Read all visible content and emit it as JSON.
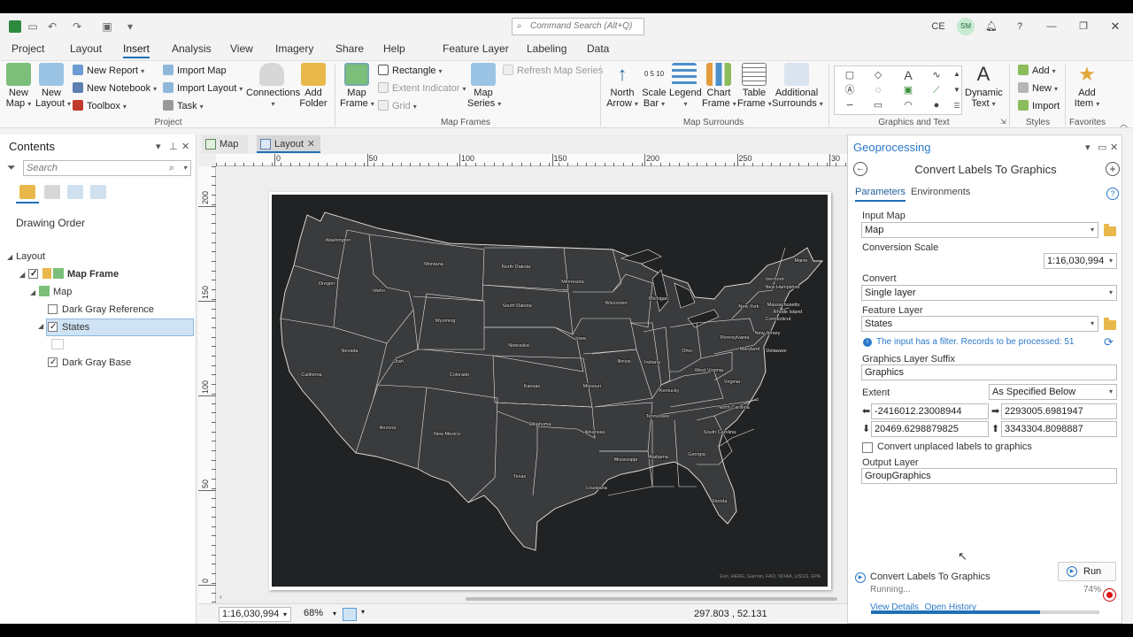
{
  "titlebar": {
    "command_search_placeholder": "Command Search (Alt+Q)",
    "user_initials": "CE",
    "avatar_initials": "SM"
  },
  "menu_tabs": [
    "Project",
    "Layout",
    "Insert",
    "Analysis",
    "View",
    "Imagery",
    "Share",
    "Help"
  ],
  "active_menu_tab": "Insert",
  "contextual_tabs": {
    "group": "Feature Layer",
    "tabs": [
      "Labeling",
      "Data"
    ]
  },
  "ribbon": {
    "project": {
      "group_label": "Project",
      "new_map": "New Map",
      "new_layout": "New Layout",
      "new_report": "New Report",
      "new_notebook": "New Notebook",
      "toolbox": "Toolbox",
      "import_map": "Import Map",
      "import_layout": "Import Layout",
      "task": "Task",
      "connections": "Connections",
      "add_folder": "Add Folder"
    },
    "map_frames": {
      "group_label": "Map Frames",
      "map_frame": "Map Frame",
      "rectangle": "Rectangle",
      "extent_indicator": "Extent Indicator",
      "grid": "Grid",
      "map_series": "Map Series",
      "refresh_map_series": "Refresh Map Series"
    },
    "map_surrounds": {
      "group_label": "Map Surrounds",
      "north_arrow": "North Arrow",
      "scale_bar": "Scale Bar",
      "legend": "Legend",
      "chart_frame": "Chart Frame",
      "table_frame": "Table Frame",
      "additional_surrounds": "Additional Surrounds"
    },
    "graphics_and_text": {
      "group_label": "Graphics and Text",
      "dynamic_text": "Dynamic Text"
    },
    "styles": {
      "group_label": "Styles",
      "add": "Add",
      "new": "New",
      "import": "Import"
    },
    "favorites": {
      "group_label": "Favorites",
      "add_item": "Add Item"
    }
  },
  "contents": {
    "title": "Contents",
    "search_placeholder": "Search",
    "section": "Drawing Order",
    "tree": [
      {
        "label": "Layout",
        "bold": false
      },
      {
        "label": "Map Frame",
        "bold": true
      },
      {
        "label": "Map",
        "bold": false
      },
      {
        "label": "Dark Gray Reference",
        "bold": false,
        "checked": false
      },
      {
        "label": "States",
        "bold": false,
        "checked": true,
        "selected": true
      },
      {
        "label": "Dark Gray Base",
        "bold": false,
        "checked": true
      }
    ]
  },
  "doc_tabs": [
    {
      "label": "Map",
      "active": false
    },
    {
      "label": "Layout",
      "active": true
    }
  ],
  "ruler": {
    "h_labels": [
      "0",
      "50",
      "100",
      "150",
      "200",
      "250",
      "30"
    ],
    "v_labels": [
      "200",
      "150",
      "100",
      "50",
      "0"
    ]
  },
  "map": {
    "states": [
      {
        "name": "Washington"
      },
      {
        "name": "Oregon"
      },
      {
        "name": "California"
      },
      {
        "name": "Idaho"
      },
      {
        "name": "Nevada"
      },
      {
        "name": "Montana"
      },
      {
        "name": "Wyoming"
      },
      {
        "name": "Utah"
      },
      {
        "name": "Arizona"
      },
      {
        "name": "Colorado"
      },
      {
        "name": "New Mexico"
      },
      {
        "name": "North Dakota"
      },
      {
        "name": "South Dakota"
      },
      {
        "name": "Nebraska"
      },
      {
        "name": "Kansas"
      },
      {
        "name": "Oklahoma"
      },
      {
        "name": "Texas"
      },
      {
        "name": "Minnesota"
      },
      {
        "name": "Iowa"
      },
      {
        "name": "Missouri"
      },
      {
        "name": "Arkansas"
      },
      {
        "name": "Louisiana"
      },
      {
        "name": "Wisconsin"
      },
      {
        "name": "Illinois"
      },
      {
        "name": "Michigan"
      },
      {
        "name": "Indiana"
      },
      {
        "name": "Ohio"
      },
      {
        "name": "Kentucky"
      },
      {
        "name": "Tennessee"
      },
      {
        "name": "Mississippi"
      },
      {
        "name": "Alabama"
      },
      {
        "name": "Georgia"
      },
      {
        "name": "Florida"
      },
      {
        "name": "South Carolina"
      },
      {
        "name": "North Carolina"
      },
      {
        "name": "Virginia"
      },
      {
        "name": "West Virginia"
      },
      {
        "name": "Pennsylvania"
      },
      {
        "name": "New York"
      },
      {
        "name": "Maine"
      },
      {
        "name": "Vermont"
      },
      {
        "name": "New Hampshire"
      },
      {
        "name": "Massachusetts"
      },
      {
        "name": "Rhode Island"
      },
      {
        "name": "Connecticut"
      },
      {
        "name": "New Jersey"
      },
      {
        "name": "Maryland"
      },
      {
        "name": "Delaware"
      }
    ],
    "attribution": "Esri, HERE, Garmin, FAO, NOAA, USGS, EPA"
  },
  "status_bar": {
    "scale": "1:16,030,994",
    "zoom": "68%",
    "coordinates": "297.803 , 52.131"
  },
  "geoprocessing": {
    "title": "Geoprocessing",
    "tool_title": "Convert Labels To Graphics",
    "tab_parameters": "Parameters",
    "tab_environments": "Environments",
    "input_map_label": "Input Map",
    "input_map_value": "Map",
    "conversion_scale_label": "Conversion Scale",
    "conversion_scale_value": "1:16,030,994",
    "convert_label": "Convert",
    "convert_value": "Single layer",
    "feature_layer_label": "Feature Layer",
    "feature_layer_value": "States",
    "filter_info": "The input has a filter. Records to be processed: 51",
    "suffix_label": "Graphics Layer Suffix",
    "suffix_value": "Graphics",
    "extent_label": "Extent",
    "extent_value": "As Specified Below",
    "extent_left": "-2416012.23008944",
    "extent_right": "2293005.6981947",
    "extent_bottom": "20469.6298879825",
    "extent_top": "3343304.8098887",
    "unplaced_label": "Convert unplaced labels to graphics",
    "unplaced_checked": false,
    "output_layer_label": "Output Layer",
    "output_layer_value": "GroupGraphics",
    "run_label": "Run",
    "status_tool": "Convert Labels To Graphics",
    "status_text": "Running...",
    "progress_percent": 74,
    "progress_label": "74%",
    "view_details": "View Details",
    "open_history": "Open History"
  }
}
